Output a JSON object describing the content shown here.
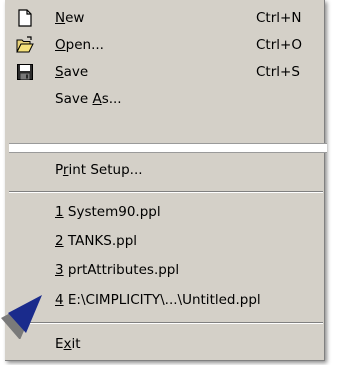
{
  "menu": {
    "items": [
      {
        "label": "New",
        "mnemonic": "N",
        "rest": "ew",
        "shortcut": "Ctrl+N",
        "icon": "new-document-icon"
      },
      {
        "label": "Open...",
        "mnemonic": "O",
        "rest": "pen...",
        "shortcut": "Ctrl+O",
        "icon": "open-folder-icon"
      },
      {
        "label": "Save",
        "mnemonic": "S",
        "rest": "ave",
        "shortcut": "Ctrl+S",
        "icon": "floppy-disk-icon"
      },
      {
        "label": "Save As...",
        "pre": "Save ",
        "mnemonic": "A",
        "rest": "s..."
      },
      {
        "label": "Print Setup...",
        "pre": "P",
        "mnemonic": "r",
        "rest": "int Setup..."
      },
      {
        "label": "1 System90.ppl",
        "mnemonic": "1",
        "rest": " System90.ppl"
      },
      {
        "label": "2 TANKS.ppl",
        "mnemonic": "2",
        "rest": " TANKS.ppl"
      },
      {
        "label": "3 prtAttributes.ppl",
        "mnemonic": "3",
        "rest": " prtAttributes.ppl"
      },
      {
        "label": "4 E:\\CIMPLICITY\\...\\Untitled.ppl",
        "mnemonic": "4",
        "rest": " E:\\CIMPLICITY\\...\\Untitled.ppl"
      },
      {
        "label": "Exit",
        "pre": "E",
        "mnemonic": "x",
        "rest": "it"
      }
    ]
  },
  "colors": {
    "menu_bg": "#d4d0c8",
    "pointer": "#1a2b8c"
  }
}
